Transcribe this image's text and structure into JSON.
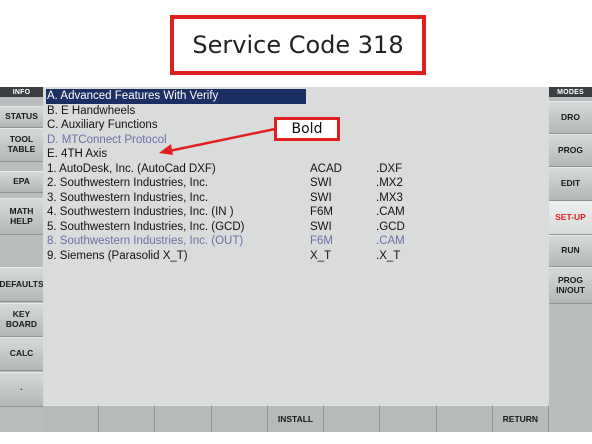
{
  "caption": {
    "title": "Service Code 318"
  },
  "left_panel": {
    "header": "INFO",
    "buttons": [
      "STATUS",
      "TOOL\nTABLE",
      "EPA",
      "MATH\nHELP",
      "DEFAULTS",
      "KEY\nBOARD",
      "CALC",
      "·"
    ]
  },
  "right_panel": {
    "header": "MODES",
    "buttons": [
      "DRO",
      "PROG",
      "EDIT",
      "SET-UP",
      "RUN",
      "PROG\nIN/OUT"
    ],
    "active": "SET-UP"
  },
  "list": {
    "rows": [
      {
        "desc": "A.  Advanced Features With Verify",
        "code": "",
        "ext": "",
        "state": "selected"
      },
      {
        "desc": "B.  E Handwheels",
        "code": "",
        "ext": "",
        "state": "normal"
      },
      {
        "desc": "C.  Auxiliary Functions",
        "code": "",
        "ext": "",
        "state": "normal"
      },
      {
        "desc": "D.  MTConnect Protocol",
        "code": "",
        "ext": "",
        "state": "dim"
      },
      {
        "desc": "E.  4TH Axis",
        "code": "",
        "ext": "",
        "state": "normal"
      },
      {
        "desc": "1.  AutoDesk, Inc. (AutoCad DXF)",
        "code": "ACAD",
        "ext": ".DXF",
        "state": "normal"
      },
      {
        "desc": "2.  Southwestern Industries, Inc.",
        "code": "SWI",
        "ext": ".MX2",
        "state": "normal"
      },
      {
        "desc": "3.  Southwestern Industries, Inc.",
        "code": "SWI",
        "ext": ".MX3",
        "state": "normal"
      },
      {
        "desc": "4.  Southwestern Industries, Inc. (IN )",
        "code": "F6M",
        "ext": ".CAM",
        "state": "normal"
      },
      {
        "desc": "5.  Southwestern Industries, Inc. (GCD)",
        "code": "SWI",
        "ext": ".GCD",
        "state": "normal"
      },
      {
        "desc": "8.  Southwestern Industries, Inc. (OUT)",
        "code": "F6M",
        "ext": ".CAM",
        "state": "dim"
      },
      {
        "desc": "9.  Siemens (Parasolid X_T)",
        "code": "X_T",
        "ext": ".X_T",
        "state": "normal"
      }
    ]
  },
  "annotation": {
    "label": "Bold",
    "color": "#e02020"
  },
  "bottom_bar": {
    "keys": [
      "",
      "",
      "",
      "",
      "INSTALL",
      "",
      "",
      "",
      "RETURN"
    ]
  },
  "colors": {
    "selection": "#1c2f63",
    "dim_text": "#6e6ea8",
    "active_mode": "#e02020"
  }
}
